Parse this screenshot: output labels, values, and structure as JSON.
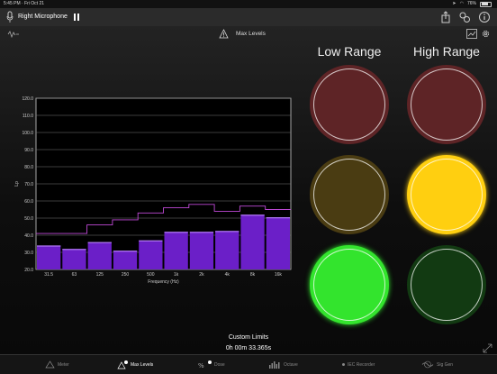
{
  "status_bar": {
    "time_date": "5:45 PM · Fri Oct 21",
    "battery": "76%",
    "battery_level": 0.76
  },
  "nav": {
    "title": "Right Microphone"
  },
  "subbar": {
    "label": "Max Levels"
  },
  "ranges": {
    "low": "Low Range",
    "high": "High Range"
  },
  "lights": {
    "low": {
      "red": "#5e2426",
      "yellow": "#4a3c12",
      "green": "#33e42d"
    },
    "high": {
      "red": "#5e2426",
      "yellow": "#ffcf10",
      "green": "#123a12"
    }
  },
  "chart_data": {
    "type": "bar",
    "xlabel": "Frequency (Hz)",
    "ylabel": "Lp",
    "ylim": [
      20,
      120
    ],
    "yticks": [
      "20.0",
      "30.0",
      "40.0",
      "50.0",
      "60.0",
      "70.0",
      "80.0",
      "90.0",
      "100.0",
      "110.0",
      "120.0"
    ],
    "categories": [
      "31.5",
      "63",
      "125",
      "250",
      "500",
      "1k",
      "2k",
      "4k",
      "8k",
      "16k"
    ],
    "values": [
      34,
      32,
      36,
      31,
      37,
      42,
      42,
      42.5,
      52,
      50.5
    ],
    "max_hold": [
      41,
      41,
      46,
      49,
      53,
      56,
      58,
      54,
      57,
      55
    ],
    "grid": true,
    "bar_color": "#6b1fc8",
    "line_color": "#c04ad8"
  },
  "footer": {
    "limits_label": "Custom Limits",
    "elapsed": "0h 00m 33.365s"
  },
  "tabs": [
    "Meter",
    "Max Levels",
    "Dose",
    "Octave",
    "IEC Recorder",
    "Sig Gen"
  ]
}
